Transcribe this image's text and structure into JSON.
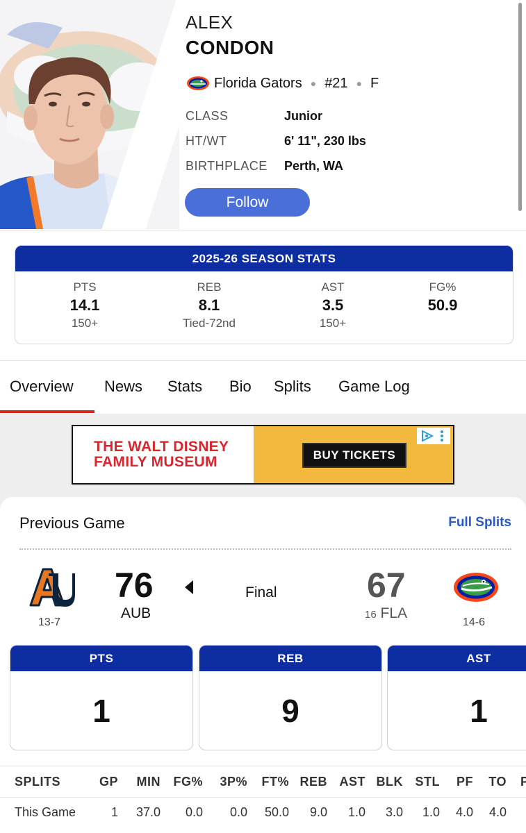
{
  "player": {
    "first_name": "ALEX",
    "last_name": "CONDON",
    "team": "Florida Gators",
    "number": "#21",
    "position": "F",
    "bio": [
      {
        "label": "CLASS",
        "value": "Junior"
      },
      {
        "label": "HT/WT",
        "value": "6' 11\", 230 lbs"
      },
      {
        "label": "BIRTHPLACE",
        "value": "Perth, WA"
      }
    ],
    "follow_label": "Follow"
  },
  "season": {
    "title": "2025-26 SEASON STATS",
    "stats": [
      {
        "label": "PTS",
        "value": "14.1",
        "rank": "150+"
      },
      {
        "label": "REB",
        "value": "8.1",
        "rank": "Tied-72nd"
      },
      {
        "label": "AST",
        "value": "3.5",
        "rank": "150+"
      },
      {
        "label": "FG%",
        "value": "50.9",
        "rank": ""
      }
    ]
  },
  "tabs": [
    "Overview",
    "News",
    "Stats",
    "Bio",
    "Splits",
    "Game Log"
  ],
  "active_tab": "Overview",
  "ad": {
    "line1": "THE WALT DISNEY",
    "line2": "FAMILY MUSEUM",
    "button": "BUY TICKETS"
  },
  "previous_game": {
    "title": "Previous Game",
    "link": "Full Splits",
    "status": "Final",
    "away": {
      "abbr": "AUB",
      "score": "76",
      "record": "13-7",
      "rank": ""
    },
    "home": {
      "abbr": "FLA",
      "score": "67",
      "record": "14-6",
      "rank": "16"
    },
    "stats": [
      {
        "label": "PTS",
        "value": "1"
      },
      {
        "label": "REB",
        "value": "9"
      },
      {
        "label": "AST",
        "value": "1"
      }
    ]
  },
  "splits": {
    "headers": [
      "SPLITS",
      "GP",
      "MIN",
      "FG%",
      "3P%",
      "FT%",
      "REB",
      "AST",
      "BLK",
      "STL",
      "PF",
      "TO",
      "P"
    ],
    "rows": [
      [
        "This Game",
        "1",
        "37.0",
        "0.0",
        "0.0",
        "50.0",
        "9.0",
        "1.0",
        "3.0",
        "1.0",
        "4.0",
        "4.0",
        ""
      ]
    ]
  },
  "colors": {
    "stat_header": "#0d2ea0",
    "follow": "#4a6fd8",
    "active_tab": "#d42a1e",
    "link": "#2a5bc4",
    "auburn_navy": "#0c2340",
    "auburn_orange": "#e87722",
    "gators_orange": "#fa4616",
    "gators_blue": "#0021a5"
  }
}
